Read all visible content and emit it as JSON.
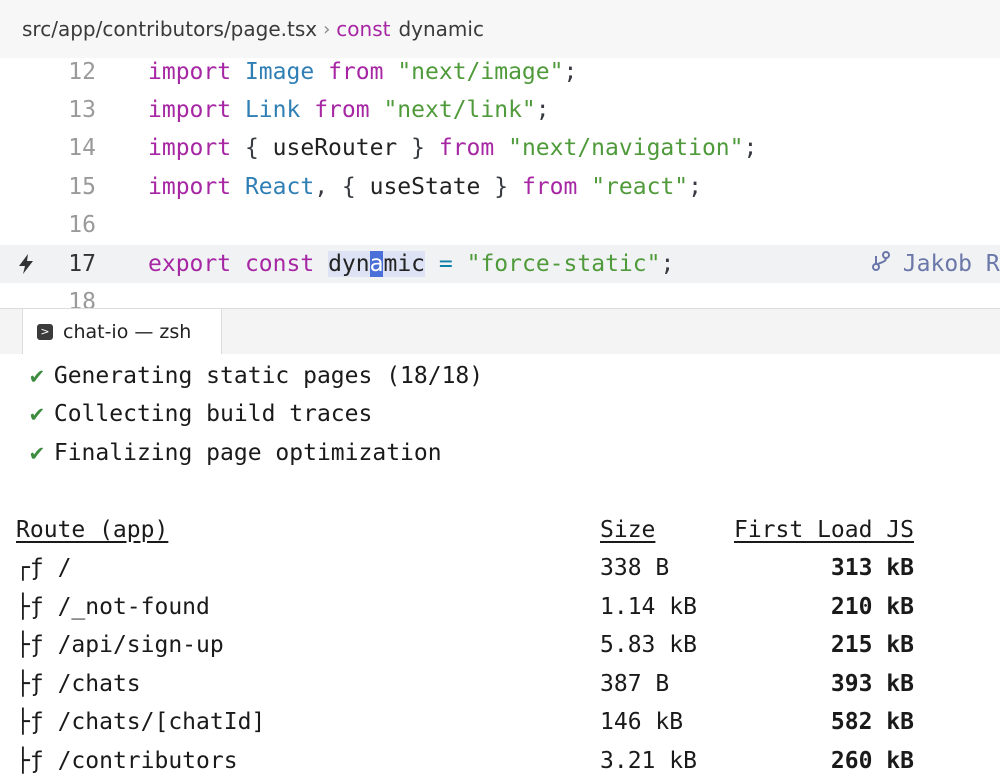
{
  "breadcrumb": {
    "path": "src/app/contributors/page.tsx",
    "separator": "›",
    "keyword": "const",
    "symbol": "dynamic"
  },
  "editor": {
    "lines": [
      {
        "num": "12",
        "kw": "import",
        "name": "Image",
        "from": "from",
        "str": "\"next/image\"",
        "end": ";"
      },
      {
        "num": "13",
        "kw": "import",
        "name": "Link",
        "from": "from",
        "str": "\"next/link\"",
        "end": ";"
      },
      {
        "num": "14",
        "kw": "import",
        "open": "{ ",
        "ident": "useRouter",
        "close": " }",
        "from": "from",
        "str": "\"next/navigation\"",
        "end": ";"
      },
      {
        "num": "15",
        "kw": "import",
        "name": "React",
        "comma": ", ",
        "open": "{ ",
        "ident": "useState",
        "close": " }",
        "from": "from",
        "str": "\"react\"",
        "end": ";"
      },
      {
        "num": "16"
      },
      {
        "num": "17",
        "kw1": "export",
        "kw2": "const",
        "ident_a": "dyn",
        "ident_cursor": "a",
        "ident_b": "mic",
        "op": "=",
        "str": "\"force-static\"",
        "end": ";",
        "blame": "Jakob Rössner,"
      },
      {
        "num": "18"
      }
    ]
  },
  "terminal": {
    "tab_title": "chat-io — zsh",
    "check_mark": "✔",
    "status_lines": [
      "Generating static pages (18/18)",
      "Collecting build traces",
      "Finalizing page optimization"
    ],
    "table": {
      "headers": {
        "route": "Route (app)",
        "size": "Size",
        "first_load": "First Load JS"
      },
      "rows": [
        {
          "prefix": "┌ƒ",
          "route": "/",
          "size": "338 B",
          "first_load": "313 kB"
        },
        {
          "prefix": "├ƒ",
          "route": "/_not-found",
          "size": "1.14 kB",
          "first_load": "210 kB"
        },
        {
          "prefix": "├ƒ",
          "route": "/api/sign-up",
          "size": "5.83 kB",
          "first_load": "215 kB"
        },
        {
          "prefix": "├ƒ",
          "route": "/chats",
          "size": "387 B",
          "first_load": "393 kB"
        },
        {
          "prefix": "├ƒ",
          "route": "/chats/[chatId]",
          "size": "146 kB",
          "first_load": "582 kB"
        },
        {
          "prefix": "├ƒ",
          "route": "/contributors",
          "size": "3.21 kB",
          "first_load": "260 kB"
        }
      ]
    }
  }
}
